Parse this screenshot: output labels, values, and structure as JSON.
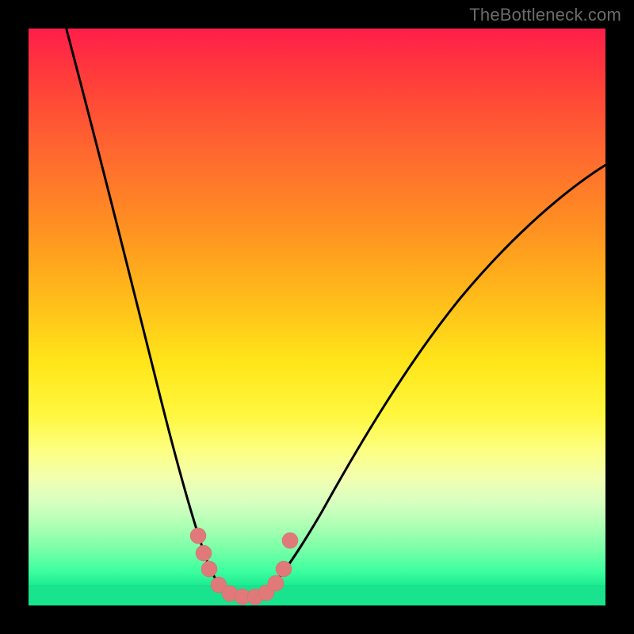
{
  "watermark": "TheBottleneck.com",
  "chart_data": {
    "type": "line",
    "title": "",
    "xlabel": "",
    "ylabel": "",
    "xlim": [
      0,
      100
    ],
    "ylim": [
      0,
      100
    ],
    "grid": false,
    "series": [
      {
        "name": "left-curve",
        "x": [
          4,
          8,
          12,
          16,
          20,
          23,
          25,
          27,
          29,
          31,
          33
        ],
        "y": [
          100,
          80,
          60,
          42,
          28,
          18,
          12,
          8,
          5,
          3,
          2
        ]
      },
      {
        "name": "right-curve",
        "x": [
          40,
          44,
          50,
          57,
          65,
          74,
          84,
          100
        ],
        "y": [
          3,
          8,
          18,
          30,
          42,
          54,
          64,
          76
        ]
      },
      {
        "name": "dip-markers",
        "x": [
          27,
          28.5,
          30,
          33,
          36,
          38.5,
          40.5,
          42,
          43
        ],
        "y": [
          11,
          8,
          5,
          2.5,
          2.5,
          2.8,
          4,
          7,
          10
        ]
      }
    ],
    "background_gradient": {
      "top": "#ff1e4a",
      "mid": "#ffe61a",
      "bottom": "#19e38c"
    },
    "marker_color": "#e07a7a",
    "line_color": "#000000"
  }
}
